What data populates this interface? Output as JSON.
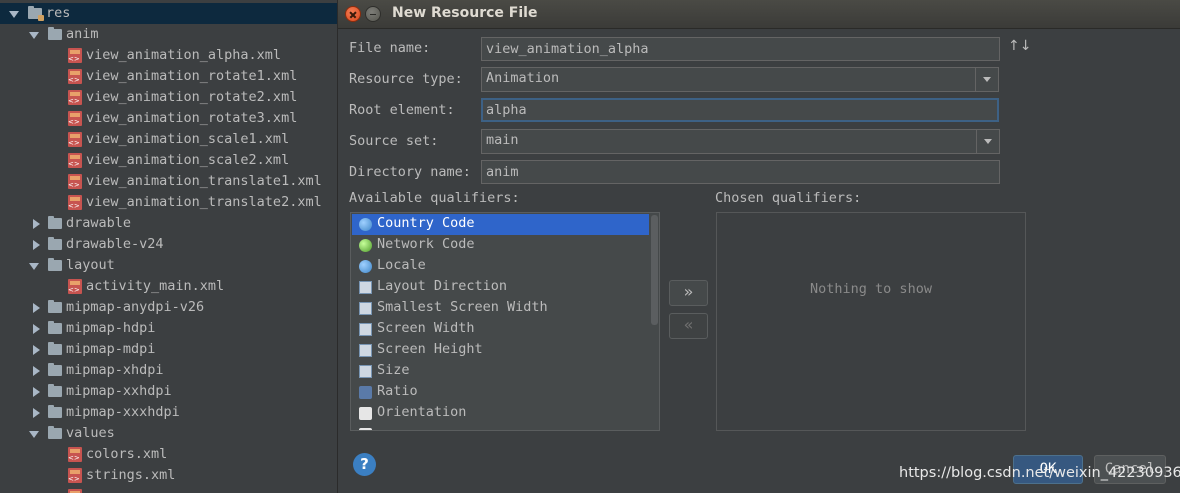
{
  "tree": {
    "res": "res",
    "anim": "anim",
    "anim_files": [
      "view_animation_alpha.xml",
      "view_animation_rotate1.xml",
      "view_animation_rotate2.xml",
      "view_animation_rotate3.xml",
      "view_animation_scale1.xml",
      "view_animation_scale2.xml",
      "view_animation_translate1.xml",
      "view_animation_translate2.xml"
    ],
    "drawable": "drawable",
    "drawable_v24": "drawable-v24",
    "layout": "layout",
    "layout_file": "activity_main.xml",
    "mipmap_anydpi": "mipmap-anydpi-v26",
    "mipmap_hdpi": "mipmap-hdpi",
    "mipmap_mdpi": "mipmap-mdpi",
    "mipmap_xhdpi": "mipmap-xhdpi",
    "mipmap_xxhdpi": "mipmap-xxhdpi",
    "mipmap_xxxhdpi": "mipmap-xxxhdpi",
    "values": "values",
    "values_files": [
      "colors.xml",
      "strings.xml"
    ]
  },
  "dialog": {
    "title": "New Resource File",
    "file_name_label": "File name:",
    "file_name_value": "view_animation_alpha",
    "resource_type_label": "Resource type:",
    "resource_type_value": "Animation",
    "root_element_label": "Root element:",
    "root_element_value": "alpha",
    "source_set_label": "Source set:",
    "source_set_value": "main",
    "directory_name_label": "Directory name:",
    "directory_name_value": "anim",
    "available_label": "Available qualifiers:",
    "chosen_label": "Chosen qualifiers:",
    "qualifiers": [
      {
        "label": "Country Code",
        "icon": "globe-icon"
      },
      {
        "label": "Network Code",
        "icon": "network-icon"
      },
      {
        "label": "Locale",
        "icon": "globe-icon"
      },
      {
        "label": "Layout Direction",
        "icon": "layout-direction-icon"
      },
      {
        "label": "Smallest Screen Width",
        "icon": "width-icon"
      },
      {
        "label": "Screen Width",
        "icon": "width-icon"
      },
      {
        "label": "Screen Height",
        "icon": "height-icon"
      },
      {
        "label": "Size",
        "icon": "size-icon"
      },
      {
        "label": "Ratio",
        "icon": "ratio-icon"
      },
      {
        "label": "Orientation",
        "icon": "orientation-icon"
      }
    ],
    "add_button": "»",
    "remove_button": "«",
    "empty_text": "Nothing to show",
    "help": "?",
    "ok": "OK",
    "cancel": "Cancel",
    "sort_icon": "↑↓"
  },
  "watermark": "https://blog.csdn.net/weixin_42230936"
}
